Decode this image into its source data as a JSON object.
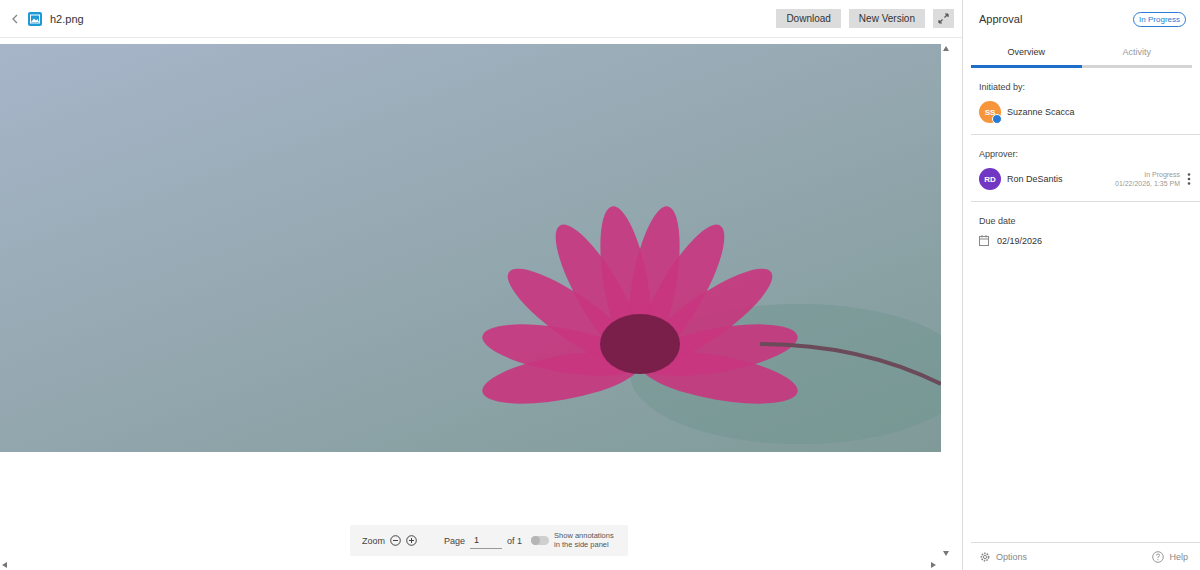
{
  "file": {
    "name": "h2.png"
  },
  "toolbar": {
    "buttons": [
      "Download",
      "New Version"
    ]
  },
  "viewer": {
    "zoom_label": "Zoom",
    "page_label": "Page",
    "page": "1",
    "page_total": "of 1",
    "annotations_toggle": {
      "label": "Show annotations in the side panel",
      "on": false
    }
  },
  "panel": {
    "title": "Approval",
    "status": "In Progress",
    "tabs": [
      {
        "label": "Overview",
        "selected": true
      },
      {
        "label": "Activity",
        "selected": false
      }
    ],
    "people": [
      {
        "heading": "Initiated by:",
        "initials": "SS",
        "name": "Suzanne Scacca",
        "color": "#f7953a",
        "kind": "initiator"
      },
      {
        "heading": "Approver:",
        "initials": "RD",
        "name": "Ron DeSantis",
        "color": "#7236c4",
        "kind": "approver",
        "status": "In Progress",
        "timestamp": "01/22/2026, 1:35 PM"
      }
    ],
    "due": {
      "heading": "Due date",
      "date": "02/19/2026"
    },
    "footer": {
      "options": "Options",
      "help": "Help"
    }
  }
}
